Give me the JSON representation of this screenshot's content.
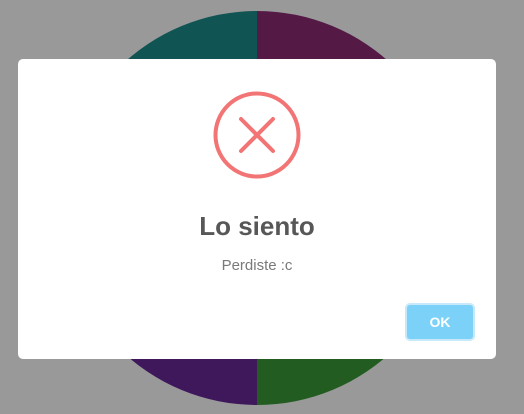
{
  "dialog": {
    "icon": "error-x-icon",
    "title": "Lo siento",
    "message": "Perdiste :c",
    "ok_label": "OK"
  },
  "wheel": {
    "segment_colors": [
      "#1b8c8c",
      "#8e2a76",
      "#3a9a37",
      "#69289a"
    ]
  },
  "colors": {
    "error_icon": "#f27474",
    "ok_button": "#7cd1f9",
    "overlay": "rgba(0,0,0,0.4)"
  }
}
